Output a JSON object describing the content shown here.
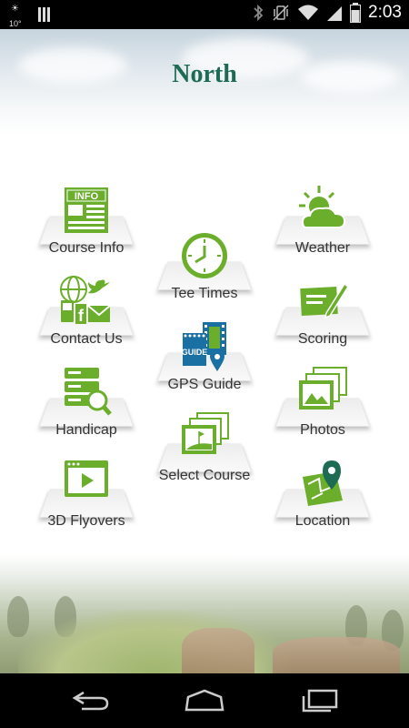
{
  "status_bar": {
    "temperature": "10°",
    "time": "2:03",
    "icons": [
      "weather-icon",
      "notification-bars-icon",
      "bluetooth-icon",
      "vibrate-icon",
      "wifi-icon",
      "signal-icon",
      "battery-icon"
    ]
  },
  "header": {
    "title": "North"
  },
  "menu": {
    "course_info": "Course Info",
    "tee_times": "Tee Times",
    "weather": "Weather",
    "contact_us": "Contact Us",
    "scoring": "Scoring",
    "gps_guide": "GPS Guide",
    "handicap": "Handicap",
    "photos": "Photos",
    "select_course": "Select Course",
    "flyovers": "3D Flyovers",
    "location": "Location"
  },
  "icon_text": {
    "info": "INFO",
    "guide": "GUIDE"
  },
  "colors": {
    "brand_green": "#6aae2c",
    "title_green": "#1e6b54",
    "accent_blue": "#1a6fa3"
  },
  "nav_bar": {
    "icons": [
      "back-icon",
      "home-icon",
      "recents-icon"
    ]
  }
}
